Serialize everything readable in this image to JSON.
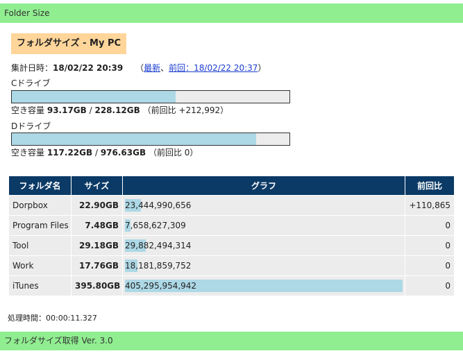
{
  "app": {
    "header": "Folder Size",
    "footer": "フォルダサイズ取得 Ver. 3.0"
  },
  "title": "フォルダサイズ - My PC",
  "aggregation": {
    "label": "集計日時：",
    "datetime": "18/02/22 20:39",
    "open": "（",
    "latest_link": "最新",
    "sep": "、",
    "prev_link": "前回：18/02/22 20:37",
    "close": "）"
  },
  "drives": [
    {
      "label": "Cドライブ",
      "used_fraction": 0.59,
      "free_label": "空き容量",
      "free": "93.17GB",
      "slash": " / ",
      "total": "228.12GB",
      "diff": "（前回比 +212,992）"
    },
    {
      "label": "Dドライブ",
      "used_fraction": 0.88,
      "free_label": "空き容量",
      "free": "117.22GB",
      "slash": " / ",
      "total": "976.63GB",
      "diff": "（前回比 0）"
    }
  ],
  "table": {
    "headers": [
      "フォルダ名",
      "サイズ",
      "グラフ",
      "前回比"
    ],
    "rows": [
      {
        "name": "Dorpbox",
        "size": "22.90GB",
        "bytes": "23,444,990,656",
        "fraction": 0.058,
        "diff": "+110,865"
      },
      {
        "name": "Program Files",
        "size": "7.48GB",
        "bytes": "7,658,627,309",
        "fraction": 0.019,
        "diff": "0"
      },
      {
        "name": "Tool",
        "size": "29.18GB",
        "bytes": "29,882,494,314",
        "fraction": 0.074,
        "diff": "0"
      },
      {
        "name": "Work",
        "size": "17.76GB",
        "bytes": "18,181,859,752",
        "fraction": 0.045,
        "diff": "0"
      },
      {
        "name": "iTunes",
        "size": "395.80GB",
        "bytes": "405,295,954,942",
        "fraction": 1.0,
        "diff": "0"
      }
    ]
  },
  "processing_time": "処理時間：00:00:11.327",
  "colors": {
    "header_bg": "#90ee90",
    "title_bg": "#ffd59a",
    "table_header": "#0b3a66",
    "bar_fill": "#add8e6"
  }
}
